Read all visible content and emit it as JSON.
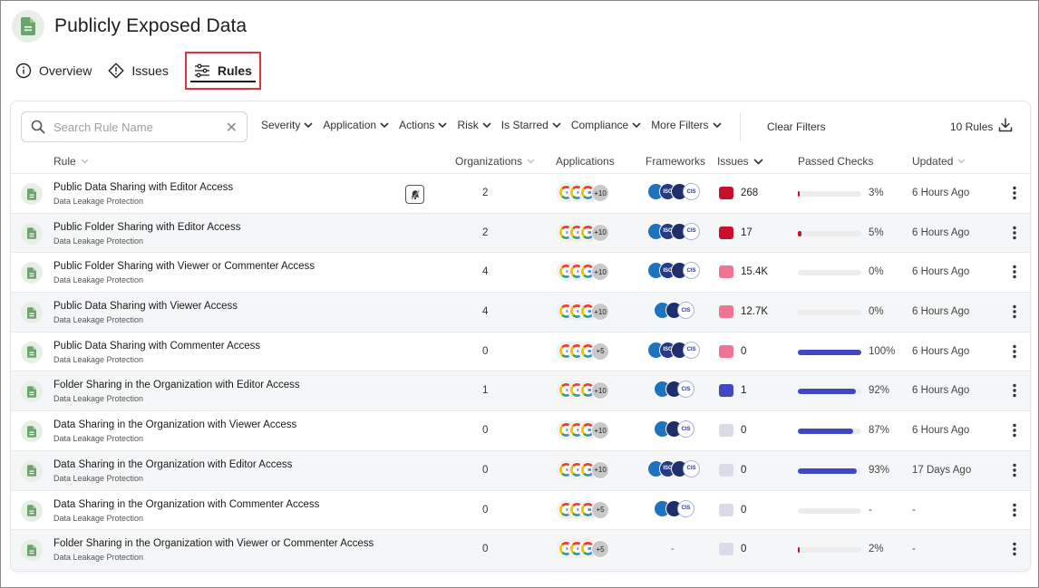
{
  "page": {
    "title": "Publicly Exposed Data"
  },
  "tabs": [
    {
      "label": "Overview",
      "icon": "info-icon"
    },
    {
      "label": "Issues",
      "icon": "warning-diamond-icon"
    },
    {
      "label": "Rules",
      "icon": "sliders-icon",
      "active": true
    }
  ],
  "search": {
    "placeholder": "Search Rule Name",
    "value": ""
  },
  "filters": [
    "Severity",
    "Application",
    "Actions",
    "Risk",
    "Is Starred",
    "Compliance",
    "More Filters"
  ],
  "clear_filters": "Clear Filters",
  "rule_count": "10 Rules",
  "columns": {
    "rule": "Rule",
    "organizations": "Organizations",
    "applications": "Applications",
    "frameworks": "Frameworks",
    "issues": "Issues",
    "passed_checks": "Passed Checks",
    "updated": "Updated"
  },
  "colors": {
    "critical": "#c8102e",
    "high": "#f27493",
    "medium": "#3f49c1",
    "none": "#d9dbe8",
    "bar_fill": "#3f49c1",
    "active_tab_border": "#e0343a"
  },
  "framework_labels": [
    "ISO",
    "CIS"
  ],
  "rows": [
    {
      "name": "Public Data Sharing with Editor Access",
      "category": "Data Leakage Protection",
      "organizations": "2",
      "apps_more": "+10",
      "frameworks": 4,
      "issue_level": "critical",
      "issues": "268",
      "passed_pct": 3,
      "passed": "3%",
      "updated": "6 Hours Ago",
      "has_bell": true
    },
    {
      "name": "Public Folder Sharing with Editor Access",
      "category": "Data Leakage Protection",
      "organizations": "2",
      "apps_more": "+10",
      "frameworks": 4,
      "issue_level": "critical",
      "issues": "17",
      "passed_pct": 5,
      "passed": "5%",
      "updated": "6 Hours Ago"
    },
    {
      "name": "Public Folder Sharing with Viewer or Commenter Access",
      "category": "Data Leakage Protection",
      "organizations": "4",
      "apps_more": "+10",
      "frameworks": 4,
      "issue_level": "high",
      "issues": "15.4K",
      "passed_pct": 0,
      "passed": "0%",
      "updated": "6 Hours Ago"
    },
    {
      "name": "Public Data Sharing with Viewer Access",
      "category": "Data Leakage Protection",
      "organizations": "4",
      "apps_more": "+10",
      "frameworks": 3,
      "issue_level": "high",
      "issues": "12.7K",
      "passed_pct": 0,
      "passed": "0%",
      "updated": "6 Hours Ago"
    },
    {
      "name": "Public Data Sharing with Commenter Access",
      "category": "Data Leakage Protection",
      "organizations": "0",
      "apps_more": "+5",
      "frameworks": 4,
      "issue_level": "high",
      "issues": "0",
      "passed_pct": 100,
      "passed": "100%",
      "updated": "6 Hours Ago"
    },
    {
      "name": "Folder Sharing in the Organization with Editor Access",
      "category": "Data Leakage Protection",
      "organizations": "1",
      "apps_more": "+10",
      "frameworks": 3,
      "issue_level": "medium",
      "issues": "1",
      "passed_pct": 92,
      "passed": "92%",
      "updated": "6 Hours Ago"
    },
    {
      "name": "Data Sharing in the Organization with Viewer Access",
      "category": "Data Leakage Protection",
      "organizations": "0",
      "apps_more": "+10",
      "frameworks": 3,
      "issue_level": "none",
      "issues": "0",
      "passed_pct": 87,
      "passed": "87%",
      "updated": "6 Hours Ago"
    },
    {
      "name": "Data Sharing in the Organization with Editor Access",
      "category": "Data Leakage Protection",
      "organizations": "0",
      "apps_more": "+10",
      "frameworks": 4,
      "issue_level": "none",
      "issues": "0",
      "passed_pct": 93,
      "passed": "93%",
      "updated": "17 Days Ago"
    },
    {
      "name": "Data Sharing in the Organization with Commenter Access",
      "category": "Data Leakage Protection",
      "organizations": "0",
      "apps_more": "+5",
      "frameworks": 3,
      "issue_level": "none",
      "issues": "0",
      "passed_pct": null,
      "passed": "-",
      "updated": "-"
    },
    {
      "name": "Folder Sharing in the Organization with Viewer or Commenter Access",
      "category": "Data Leakage Protection",
      "organizations": "0",
      "apps_more": "+5",
      "frameworks": 0,
      "frameworks_text": "-",
      "issue_level": "none",
      "issues": "0",
      "passed_pct": 2,
      "passed": "2%",
      "updated": "-"
    }
  ]
}
